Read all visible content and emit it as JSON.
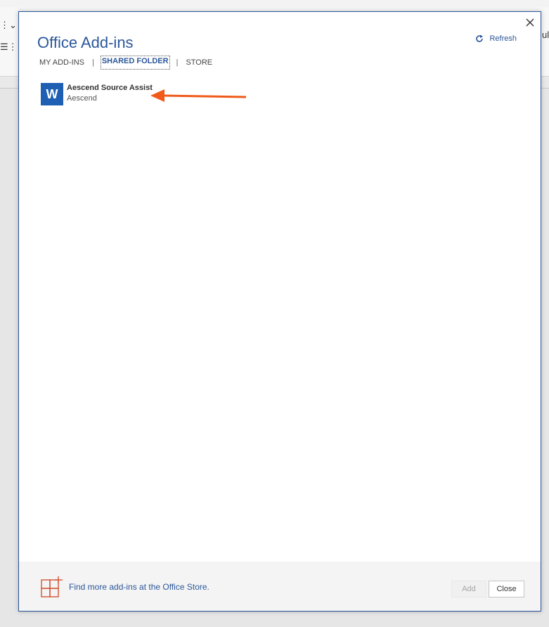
{
  "background": {
    "right_edge_text": "ul"
  },
  "dialog": {
    "title": "Office Add-ins",
    "refresh_label": "Refresh",
    "tabs": [
      {
        "label": "MY ADD-INS",
        "active": false
      },
      {
        "label": "SHARED FOLDER",
        "active": true
      },
      {
        "label": "STORE",
        "active": false
      }
    ],
    "tab_separator": "|",
    "addins": [
      {
        "name": "Aescend Source Assist",
        "publisher": "Aescend",
        "icon_letter": "W"
      }
    ],
    "footer": {
      "store_link_label": "Find more add-ins at the Office Store.",
      "add_label": "Add",
      "close_label": "Close"
    }
  },
  "colors": {
    "accent": "#2b579a",
    "word_icon": "#1e5fb4",
    "annotation_arrow": "#f05a1a",
    "store_icon": "#d24726"
  }
}
